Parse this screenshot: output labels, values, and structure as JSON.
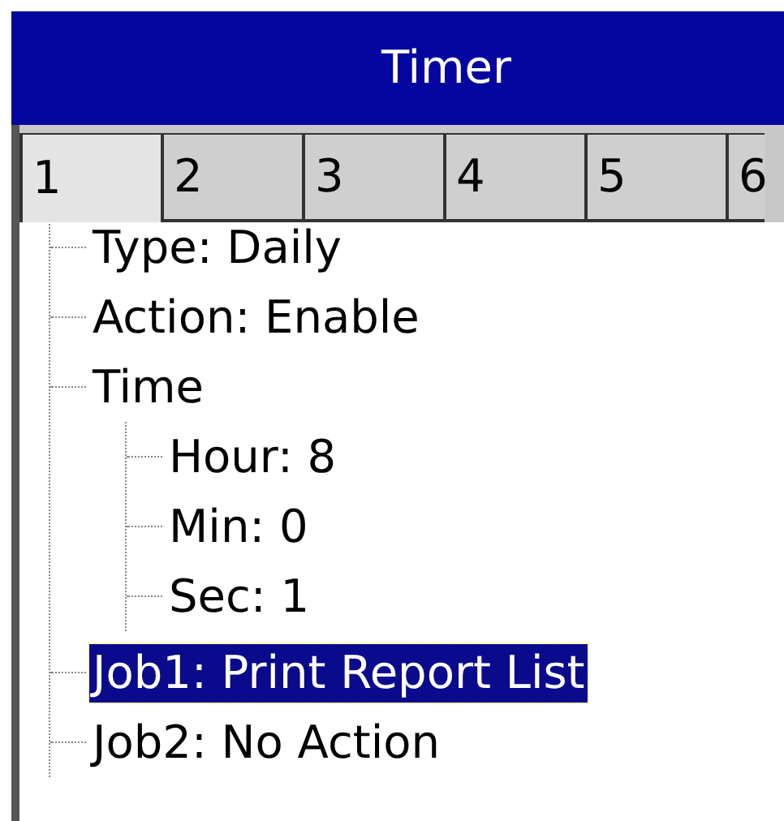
{
  "window": {
    "title": "Timer"
  },
  "tabs": [
    {
      "label": "1",
      "selected": true
    },
    {
      "label": "2",
      "selected": false
    },
    {
      "label": "3",
      "selected": false
    },
    {
      "label": "4",
      "selected": false
    },
    {
      "label": "5",
      "selected": false
    },
    {
      "label": "6",
      "selected": false
    }
  ],
  "tree": [
    {
      "label": "Type: Daily",
      "selected": false
    },
    {
      "label": "Action: Enable",
      "selected": false
    },
    {
      "label": "Time",
      "selected": false,
      "children": [
        {
          "label": "Hour: 8",
          "selected": false
        },
        {
          "label": "Min: 0",
          "selected": false
        },
        {
          "label": "Sec: 1",
          "selected": false
        }
      ]
    },
    {
      "label": "Job1: Print Report List",
      "selected": true
    },
    {
      "label": "Job2: No Action",
      "selected": false
    }
  ]
}
